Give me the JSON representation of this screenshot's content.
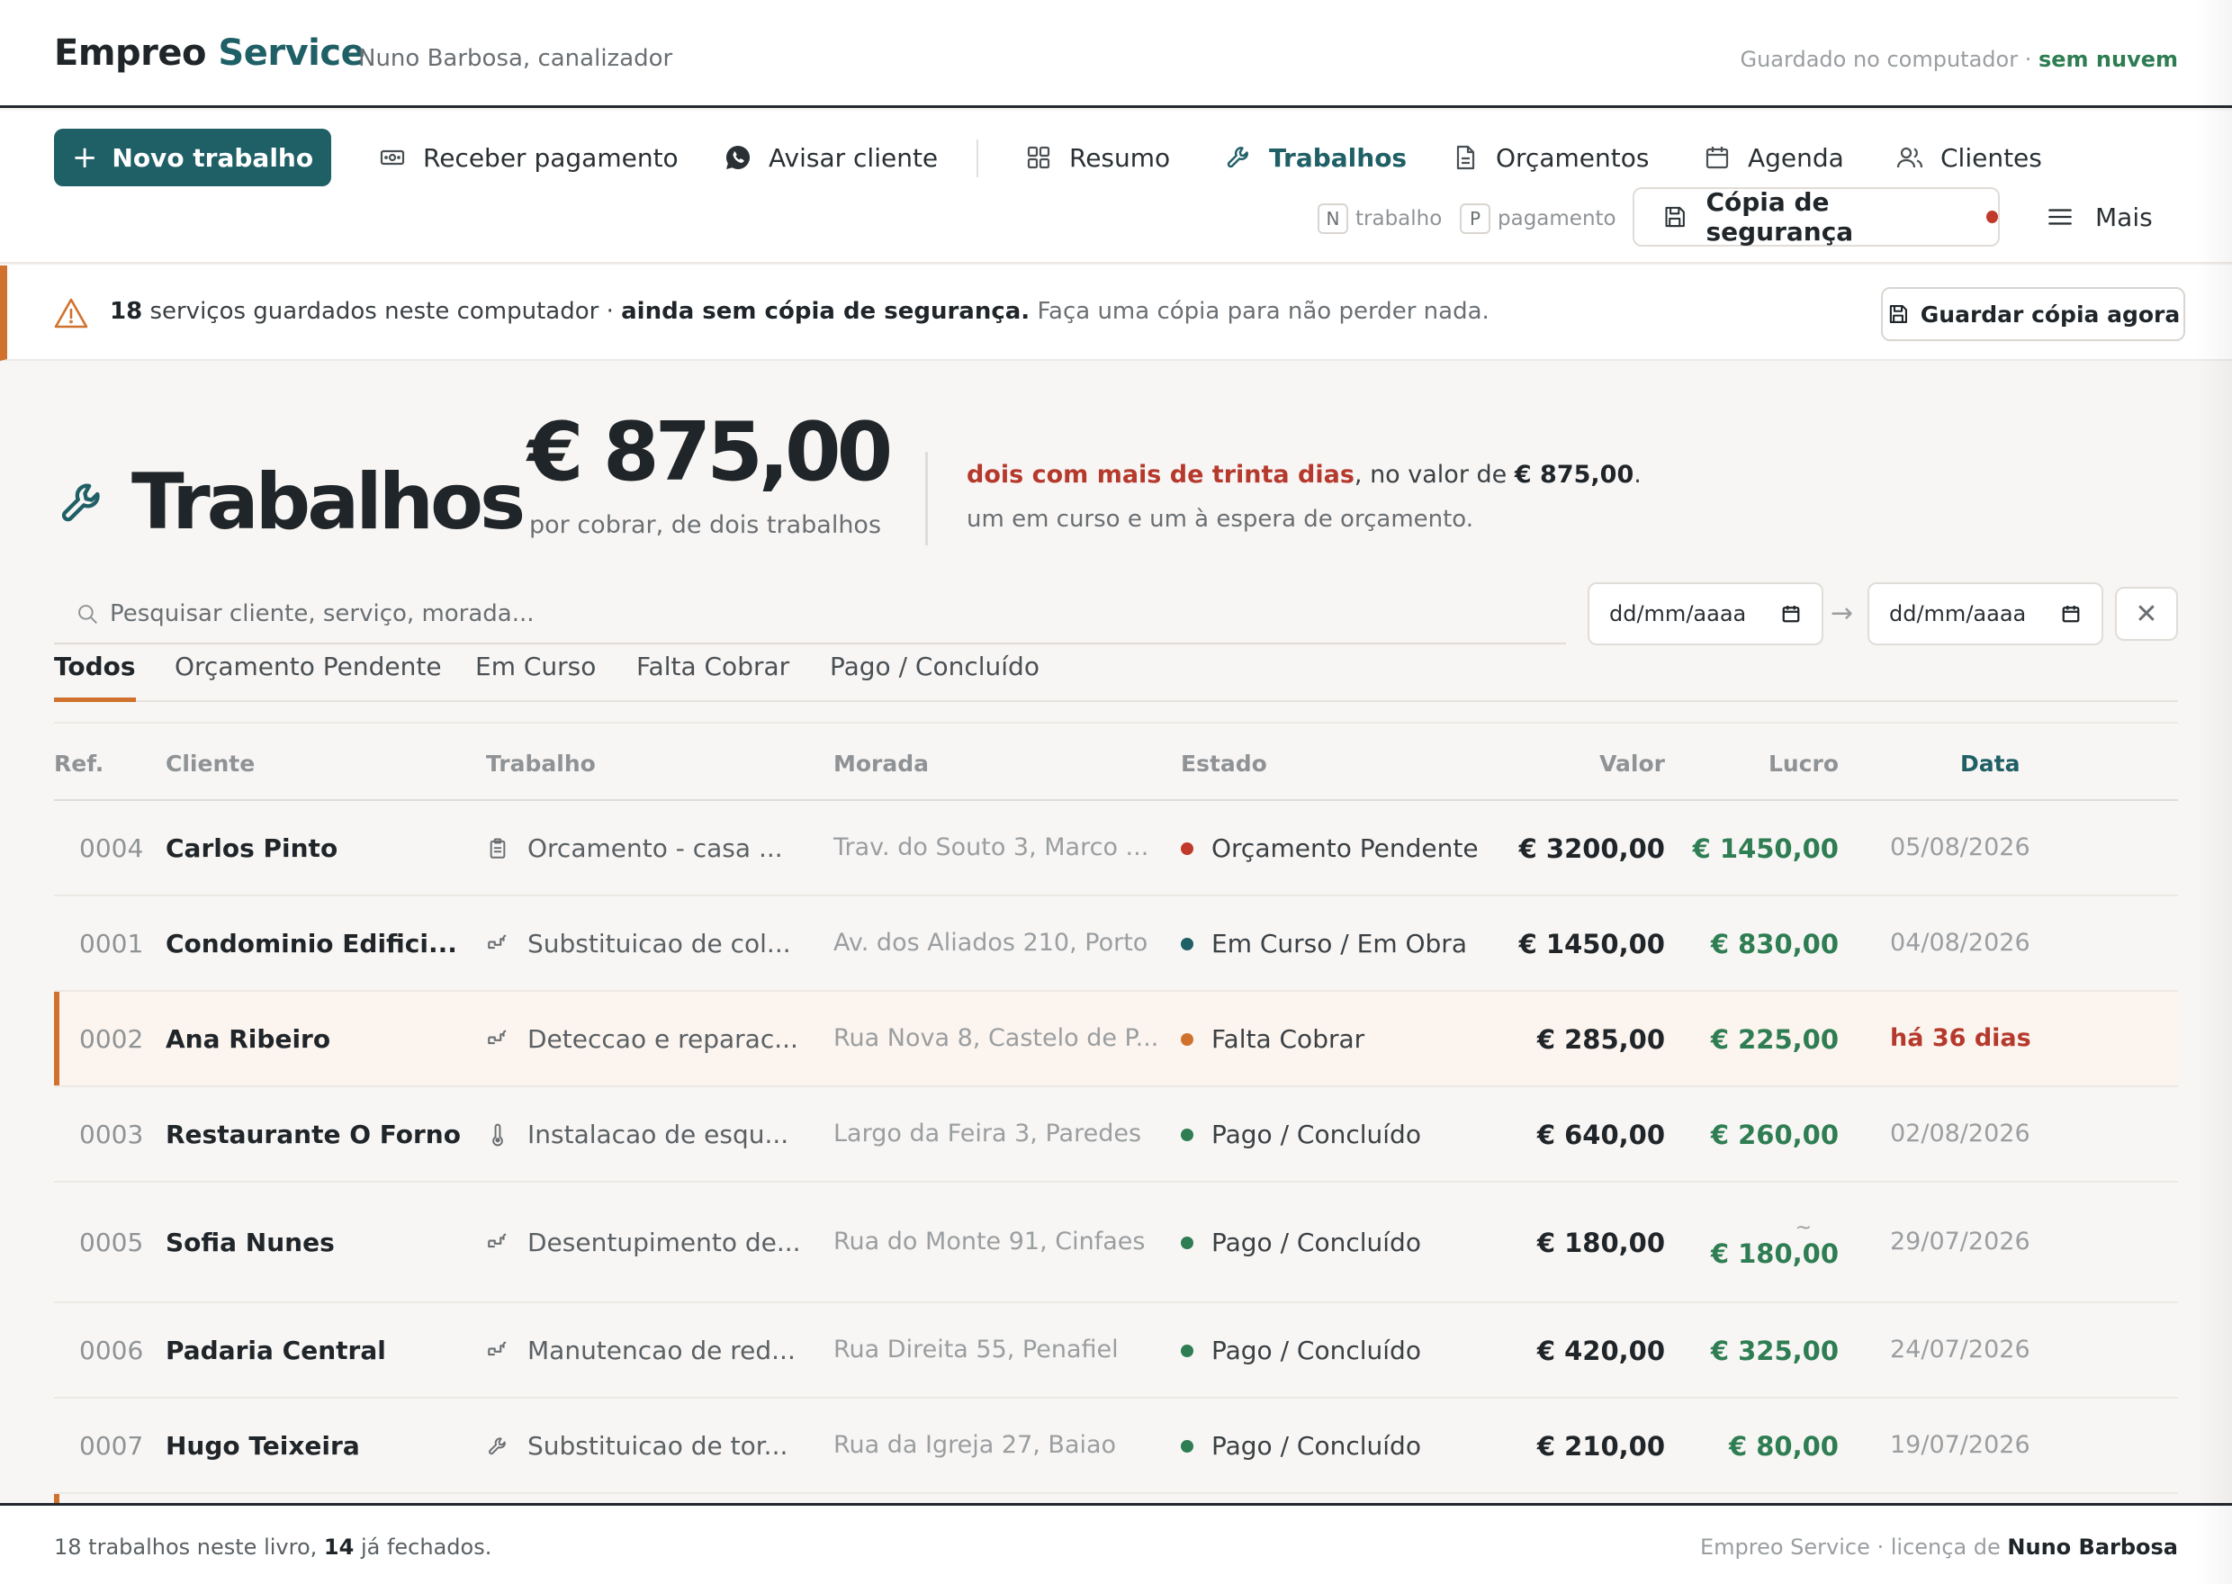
{
  "header": {
    "brand_part1": "Empreo",
    "brand_part2": "Service",
    "owner": "Nuno Barbosa, canalizador",
    "save_state_prefix": "Guardado no computador · ",
    "save_state_accent": "sem nuvem"
  },
  "toolbar": {
    "new_job": "Novo trabalho",
    "receive_payment": "Receber pagamento",
    "notify_client": "Avisar cliente",
    "nav": {
      "summary": "Resumo",
      "jobs": "Trabalhos",
      "quotes": "Orçamentos",
      "agenda": "Agenda",
      "clients": "Clientes"
    },
    "hint_n_key": "N",
    "hint_n_label": "trabalho",
    "hint_p_key": "P",
    "hint_p_label": "pagamento",
    "backup": "Cópia de segurança",
    "more": "Mais"
  },
  "banner": {
    "count": "18",
    "text1": " serviços guardados neste computador · ",
    "strong": "ainda sem cópia de segurança.",
    "text2": " Faça uma cópia para não perder nada.",
    "button": "Guardar cópia agora"
  },
  "hero": {
    "title": "Trabalhos",
    "amount": "€ 875,00",
    "subtitle": "por cobrar, de dois trabalhos",
    "note_red": "dois com mais de trinta dias",
    "note_mid": ", no valor de ",
    "note_amount": "€ 875,00",
    "note_end": ".",
    "note2": "um em curso e um à espera de orçamento."
  },
  "filters": {
    "search_placeholder": "Pesquisar cliente, serviço, morada...",
    "date_from": "dd/mm/aaaa",
    "date_to": "dd/mm/aaaa",
    "arrow": "→",
    "clear": "✕"
  },
  "tabs": [
    "Todos",
    "Orçamento Pendente",
    "Em Curso",
    "Falta Cobrar",
    "Pago / Concluído"
  ],
  "table": {
    "headers": {
      "ref": "Ref.",
      "client": "Cliente",
      "job": "Trabalho",
      "address": "Morada",
      "status": "Estado",
      "value": "Valor",
      "profit": "Lucro",
      "date": "Data"
    },
    "rows": [
      {
        "ref": "0004",
        "client": "Carlos Pinto",
        "job": "Orcamento - casa ...",
        "icon": "clipboard-icon",
        "address": "Trav. do Souto 3, Marco ...",
        "status": "Orçamento Pendente",
        "status_color": "#c0392b",
        "value": "€ 3200,00",
        "profit": "€ 1450,00",
        "profit_tilde": "",
        "date": "05/08/2026",
        "late": false
      },
      {
        "ref": "0001",
        "client": "Condominio Edifici...",
        "job": "Substituicao de col...",
        "icon": "pipe-icon",
        "address": "Av. dos Aliados 210, Porto",
        "status": "Em Curso / Em Obra",
        "status_color": "#1f5f66",
        "value": "€ 1450,00",
        "profit": "€ 830,00",
        "profit_tilde": "",
        "date": "04/08/2026",
        "late": false
      },
      {
        "ref": "0002",
        "client": "Ana Ribeiro",
        "job": "Deteccao e reparac...",
        "icon": "pipe-icon",
        "address": "Rua Nova 8, Castelo de P...",
        "status": "Falta Cobrar",
        "status_color": "#d0722e",
        "value": "€ 285,00",
        "profit": "€ 225,00",
        "profit_tilde": "",
        "date": "há 36 dias",
        "late": true
      },
      {
        "ref": "0003",
        "client": "Restaurante O Forno",
        "job": "Instalacao de esqu...",
        "icon": "thermometer-icon",
        "address": "Largo da Feira 3, Paredes",
        "status": "Pago / Concluído",
        "status_color": "#2f7d53",
        "value": "€ 640,00",
        "profit": "€ 260,00",
        "profit_tilde": "",
        "date": "02/08/2026",
        "late": false
      },
      {
        "ref": "0005",
        "client": "Sofia Nunes",
        "job": "Desentupimento de...",
        "icon": "pipe-icon",
        "address": "Rua do Monte 91, Cinfaes",
        "status": "Pago / Concluído",
        "status_color": "#2f7d53",
        "value": "€ 180,00",
        "profit": "€ 180,00",
        "profit_tilde": "~",
        "date": "29/07/2026",
        "late": false
      },
      {
        "ref": "0006",
        "client": "Padaria Central",
        "job": "Manutencao de red...",
        "icon": "pipe-icon",
        "address": "Rua Direita 55, Penafiel",
        "status": "Pago / Concluído",
        "status_color": "#2f7d53",
        "value": "€ 420,00",
        "profit": "€ 325,00",
        "profit_tilde": "",
        "date": "24/07/2026",
        "late": false
      },
      {
        "ref": "0007",
        "client": "Hugo Teixeira",
        "job": "Substituicao de tor...",
        "icon": "wrench-icon",
        "address": "Rua da Igreja 27, Baiao",
        "status": "Pago / Concluído",
        "status_color": "#2f7d53",
        "value": "€ 210,00",
        "profit": "€ 80,00",
        "profit_tilde": "",
        "date": "19/07/2026",
        "late": false
      }
    ]
  },
  "footer": {
    "left_prefix": "18 trabalhos neste livro, ",
    "left_bold": "14",
    "left_suffix": " já fechados.",
    "right_prefix": "Empreo Service · licença de ",
    "right_bold": "Nuno Barbosa"
  },
  "colors": {
    "brand": "#1f5f66",
    "warning": "#d0722e",
    "danger": "#b5392c",
    "success": "#2f7d53"
  }
}
